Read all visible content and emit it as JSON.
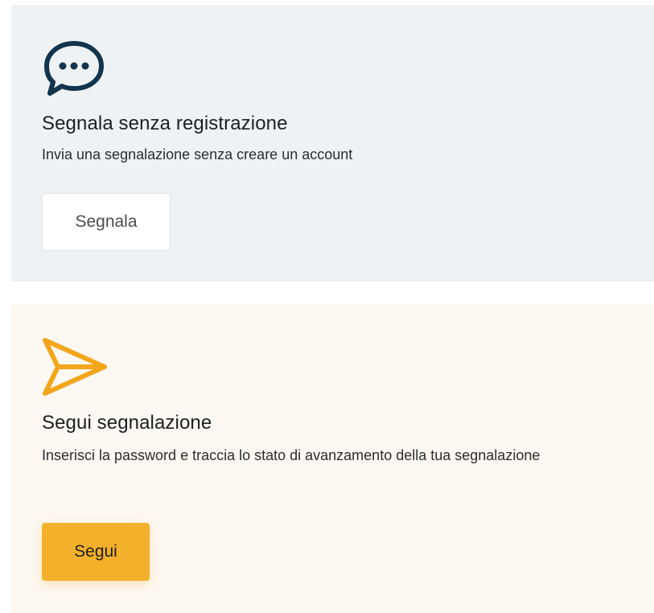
{
  "cards": [
    {
      "icon": "chat-bubble-icon",
      "title": "Segnala senza registrazione",
      "description": "Invia una segnalazione senza creare un account",
      "button_label": "Segnala",
      "color": "#eff2f4",
      "icon_color": "#12344d"
    },
    {
      "icon": "send-arrow-icon",
      "title": "Segui segnalazione",
      "description": "Inserisci la password e traccia lo stato di avanzamento della tua segnalazione",
      "button_label": "Segui",
      "color": "#fdf8f2",
      "icon_color": "#f3a61b",
      "button_color": "#f3b12b"
    }
  ]
}
